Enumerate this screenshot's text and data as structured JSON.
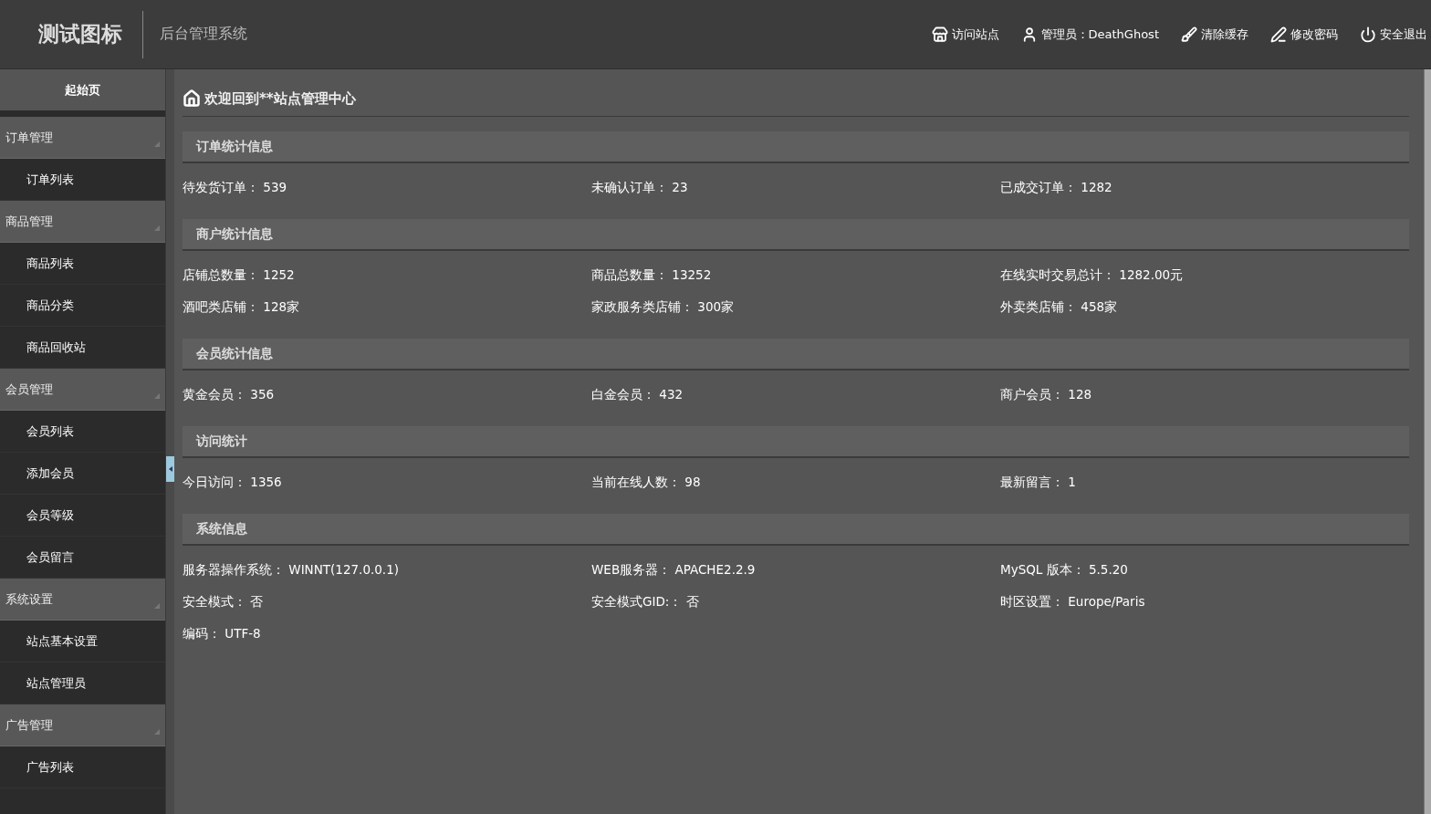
{
  "header": {
    "logo": "测试图标",
    "subtitle": "后台管理系统",
    "actions": [
      {
        "kind": "store",
        "label": "访问站点"
      },
      {
        "kind": "user",
        "label": "管理员：DeathGhost"
      },
      {
        "kind": "broom",
        "label": "清除缓存"
      },
      {
        "kind": "pen",
        "label": "修改密码"
      },
      {
        "kind": "power",
        "label": "安全退出"
      }
    ]
  },
  "sidebar": {
    "home": "起始页",
    "groups": [
      {
        "label": "订单管理",
        "expanded": true,
        "children": [
          {
            "label": "订单列表"
          }
        ]
      },
      {
        "label": "商品管理",
        "expanded": true,
        "children": [
          {
            "label": "商品列表"
          },
          {
            "label": "商品分类"
          },
          {
            "label": "商品回收站"
          }
        ]
      },
      {
        "label": "会员管理",
        "expanded": true,
        "children": [
          {
            "label": "会员列表"
          },
          {
            "label": "添加会员"
          },
          {
            "label": "会员等级"
          },
          {
            "label": "会员留言"
          }
        ]
      },
      {
        "label": "系统设置",
        "expanded": true,
        "children": [
          {
            "label": "站点基本设置"
          },
          {
            "label": "站点管理员"
          }
        ]
      },
      {
        "label": "广告管理",
        "expanded": true,
        "children": [
          {
            "label": "广告列表"
          }
        ]
      }
    ]
  },
  "main": {
    "title": "欢迎回到**站点管理中心",
    "sections": [
      {
        "title": "订单统计信息",
        "stats": [
          "待发货订单： 539",
          "未确认订单： 23",
          "已成交订单： 1282"
        ]
      },
      {
        "title": "商户统计信息",
        "stats": [
          "店铺总数量： 1252",
          "商品总数量： 13252",
          "在线实时交易总计： 1282.00元",
          "酒吧类店铺： 128家",
          "家政服务类店铺： 300家",
          "外卖类店铺： 458家"
        ]
      },
      {
        "title": "会员统计信息",
        "stats": [
          "黄金会员： 356",
          "白金会员： 432",
          "商户会员： 128"
        ]
      },
      {
        "title": "访问统计",
        "stats": [
          "今日访问： 1356",
          "当前在线人数： 98",
          "最新留言： 1"
        ]
      },
      {
        "title": "系统信息",
        "stats": [
          "服务器操作系统： WINNT(127.0.0.1)",
          "WEB服务器： APACHE2.2.9",
          "MySQL 版本： 5.5.20",
          "安全模式： 否",
          "安全模式GID:： 否",
          "时区设置： Europe/Paris",
          "编码： UTF-8"
        ]
      }
    ]
  }
}
